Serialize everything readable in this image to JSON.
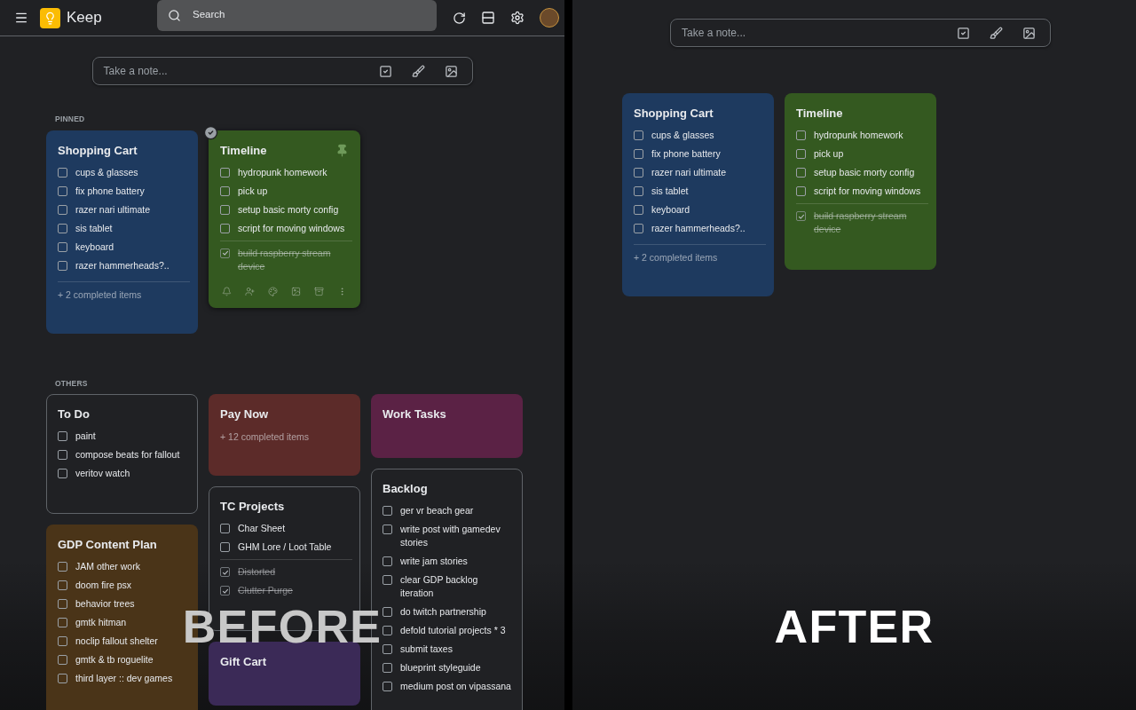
{
  "panels": [
    {
      "caption": "BEFORE",
      "header": {
        "app_name": "Keep",
        "search": {
          "placeholder": "Search"
        }
      },
      "note_bar": {
        "placeholder": "Take a note..."
      },
      "sections": [
        {
          "label": "PINNED",
          "columns": [
            [
              {
                "title": "Shopping Cart",
                "color": "#1e3a5f",
                "outlined": false,
                "hovered": false,
                "items": [
                  {
                    "text": "cups & glasses",
                    "checked": false
                  },
                  {
                    "text": "fix phone battery",
                    "checked": false
                  },
                  {
                    "text": "razer nari ultimate",
                    "checked": false
                  },
                  {
                    "text": "sis tablet",
                    "checked": false
                  },
                  {
                    "text": "keyboard",
                    "checked": false
                  },
                  {
                    "text": "razer hammerheads?..",
                    "checked": false
                  }
                ],
                "completed_summary": "+ 2 completed items"
              }
            ],
            [
              {
                "title": "Timeline",
                "color": "#345920",
                "outlined": false,
                "hovered": true,
                "items": [
                  {
                    "text": "hydropunk homework",
                    "checked": false
                  },
                  {
                    "text": "pick up",
                    "checked": false
                  },
                  {
                    "text": "setup basic morty config",
                    "checked": false
                  },
                  {
                    "text": "script for moving windows",
                    "checked": false
                  },
                  {
                    "text": "build raspberry stream device",
                    "checked": true
                  }
                ]
              }
            ]
          ]
        },
        {
          "label": "OTHERS",
          "columns": [
            [
              {
                "title": "To Do",
                "color": "#202124",
                "outlined": true,
                "hovered": false,
                "items": [
                  {
                    "text": "paint",
                    "checked": false
                  },
                  {
                    "text": "compose beats for fallout",
                    "checked": false
                  },
                  {
                    "text": "veritov watch",
                    "checked": false
                  }
                ]
              },
              {
                "title": "GDP Content Plan",
                "color": "#4a3418",
                "outlined": false,
                "hovered": false,
                "items": [
                  {
                    "text": "JAM other work",
                    "checked": false
                  },
                  {
                    "text": "doom fire psx",
                    "checked": false
                  },
                  {
                    "text": "behavior trees",
                    "checked": false
                  },
                  {
                    "text": "gmtk hitman",
                    "checked": false
                  },
                  {
                    "text": "noclip fallout shelter",
                    "checked": false
                  },
                  {
                    "text": "gmtk & tb roguelite",
                    "checked": false
                  },
                  {
                    "text": "third layer :: dev games",
                    "checked": false
                  }
                ]
              }
            ],
            [
              {
                "title": "Pay Now",
                "color": "#5c2b29",
                "outlined": false,
                "hovered": false,
                "completed_summary": "+ 12 completed items"
              },
              {
                "title": "TC Projects",
                "color": "#202124",
                "outlined": true,
                "hovered": false,
                "items": [
                  {
                    "text": "Char Sheet",
                    "checked": false
                  },
                  {
                    "text": "GHM Lore / Loot Table",
                    "checked": false
                  },
                  {
                    "text": "Distorted",
                    "checked": true
                  },
                  {
                    "text": "Clutter Purge",
                    "checked": true
                  }
                ]
              },
              {
                "title": "Gift Cart",
                "color": "#3b2a57",
                "outlined": false,
                "hovered": false
              }
            ],
            [
              {
                "title": "Work Tasks",
                "color": "#5b2245",
                "outlined": false,
                "hovered": false
              },
              {
                "title": "Backlog",
                "color": "#202124",
                "outlined": true,
                "hovered": false,
                "items": [
                  {
                    "text": "ger vr beach gear",
                    "checked": false
                  },
                  {
                    "text": "write post with gamedev stories",
                    "checked": false
                  },
                  {
                    "text": "write jam stories",
                    "checked": false
                  },
                  {
                    "text": "clear GDP backlog iteration",
                    "checked": false
                  },
                  {
                    "text": "do twitch partnership",
                    "checked": false
                  },
                  {
                    "text": "defold tutorial projects * 3",
                    "checked": false
                  },
                  {
                    "text": "submit taxes",
                    "checked": false
                  },
                  {
                    "text": "blueprint styleguide",
                    "checked": false
                  },
                  {
                    "text": "medium post on vipassana",
                    "checked": false
                  }
                ]
              }
            ]
          ]
        }
      ]
    },
    {
      "caption": "AFTER",
      "note_bar": {
        "placeholder": "Take a note..."
      },
      "sections": [
        {
          "columns": [
            [
              {
                "title": "Shopping Cart",
                "color": "#1e3a5f",
                "outlined": false,
                "hovered": false,
                "items": [
                  {
                    "text": "cups & glasses",
                    "checked": false
                  },
                  {
                    "text": "fix phone battery",
                    "checked": false
                  },
                  {
                    "text": "razer nari ultimate",
                    "checked": false
                  },
                  {
                    "text": "sis tablet",
                    "checked": false
                  },
                  {
                    "text": "keyboard",
                    "checked": false
                  },
                  {
                    "text": "razer hammerheads?..",
                    "checked": false
                  }
                ],
                "completed_summary": "+ 2 completed items"
              }
            ],
            [
              {
                "title": "Timeline",
                "color": "#345920",
                "outlined": false,
                "hovered": false,
                "items": [
                  {
                    "text": "hydropunk homework",
                    "checked": false
                  },
                  {
                    "text": "pick up",
                    "checked": false
                  },
                  {
                    "text": "setup basic morty config",
                    "checked": false
                  },
                  {
                    "text": "script for moving windows",
                    "checked": false
                  },
                  {
                    "text": "build raspberry stream device",
                    "checked": true
                  }
                ]
              }
            ]
          ]
        }
      ]
    }
  ]
}
